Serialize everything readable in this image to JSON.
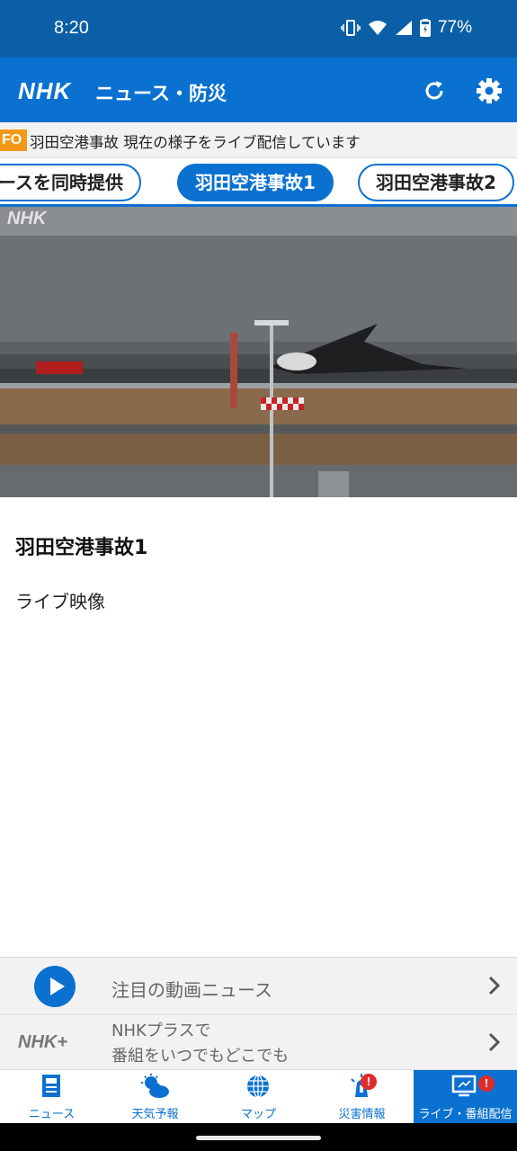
{
  "status_bar": {
    "time": "8:20",
    "battery": "77%"
  },
  "app_bar": {
    "logo": "NHK",
    "title": "ニュース・防災",
    "icons": [
      "refresh-icon",
      "settings-icon"
    ]
  },
  "ticker": {
    "tag": "FO",
    "text": "羽田空港事故 現在の様子をライブ配信しています"
  },
  "tabs": [
    {
      "label": "ースを同時提供",
      "active": false
    },
    {
      "label": "羽田空港事故1",
      "active": true
    },
    {
      "label": "羽田空港事故2",
      "active": false
    }
  ],
  "video": {
    "watermark": "NHK"
  },
  "content": {
    "title": "羽田空港事故1",
    "description": "ライブ映像"
  },
  "promo": {
    "video_news": "注目の動画ニュース",
    "plus_logo": "NHK+",
    "plus_line1": "NHKプラスで",
    "plus_line2": "番組をいつでもどこでも"
  },
  "bottom_nav": [
    {
      "label": "ニュース",
      "icon": "news-icon",
      "active": false,
      "badge": ""
    },
    {
      "label": "天気予報",
      "icon": "weather-icon",
      "active": false,
      "badge": ""
    },
    {
      "label": "マップ",
      "icon": "globe-icon",
      "active": false,
      "badge": ""
    },
    {
      "label": "災害情報",
      "icon": "alert-siren-icon",
      "active": false,
      "badge": "!"
    },
    {
      "label": "ライブ・番組配信",
      "icon": "live-tv-icon",
      "active": true,
      "badge": "!"
    }
  ],
  "colors": {
    "primary": "#0a71d1",
    "status_bar": "#0a5fa7",
    "ticker_tag": "#f29a18",
    "badge": "#e02b2b"
  }
}
